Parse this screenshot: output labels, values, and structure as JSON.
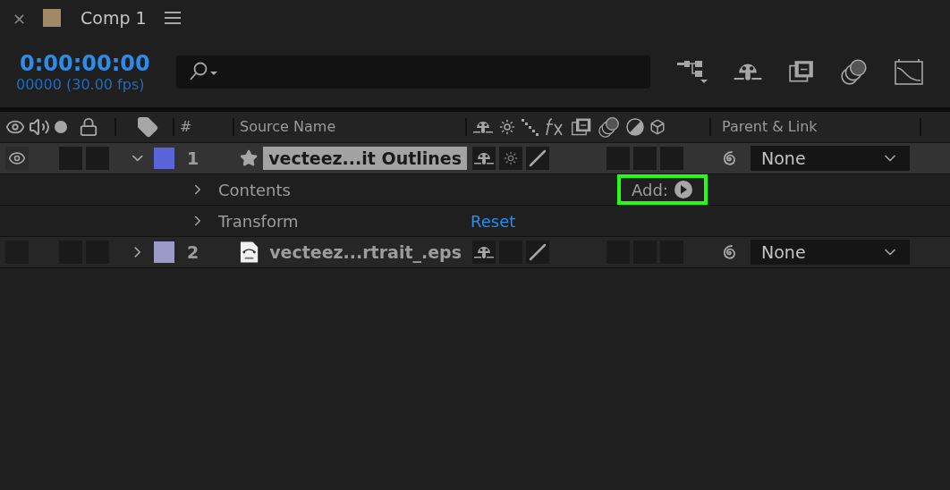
{
  "panel_tab": {
    "close": "×",
    "title": "Comp 1"
  },
  "time": {
    "timecode": "0:00:00:00",
    "frames": "00000 (30.00 fps)"
  },
  "columns": {
    "number": "#",
    "source_name": "Source Name",
    "parent": "Parent & Link"
  },
  "layers": [
    {
      "number": "1",
      "name": "vecteez...it Outlines",
      "kind": "shape",
      "color": "#5a64d8",
      "visible": true,
      "expanded": true,
      "selected": true,
      "shy": true,
      "collapse": true,
      "quality": true,
      "effects": false,
      "motion_blur": false,
      "adjustment": false,
      "parent": "None",
      "properties": [
        {
          "label": "Contents",
          "kind": "add",
          "action": "Add:",
          "highlighted": true
        },
        {
          "label": "Transform",
          "kind": "reset",
          "action": "Reset",
          "highlighted": false
        }
      ]
    },
    {
      "number": "2",
      "name": "vecteez...rtrait_.eps",
      "kind": "eps",
      "color": "#9c9ac8",
      "visible": false,
      "expanded": false,
      "selected": false,
      "shy": true,
      "collapse": false,
      "quality": true,
      "effects": false,
      "motion_blur": false,
      "adjustment": false,
      "parent": "None"
    }
  ]
}
